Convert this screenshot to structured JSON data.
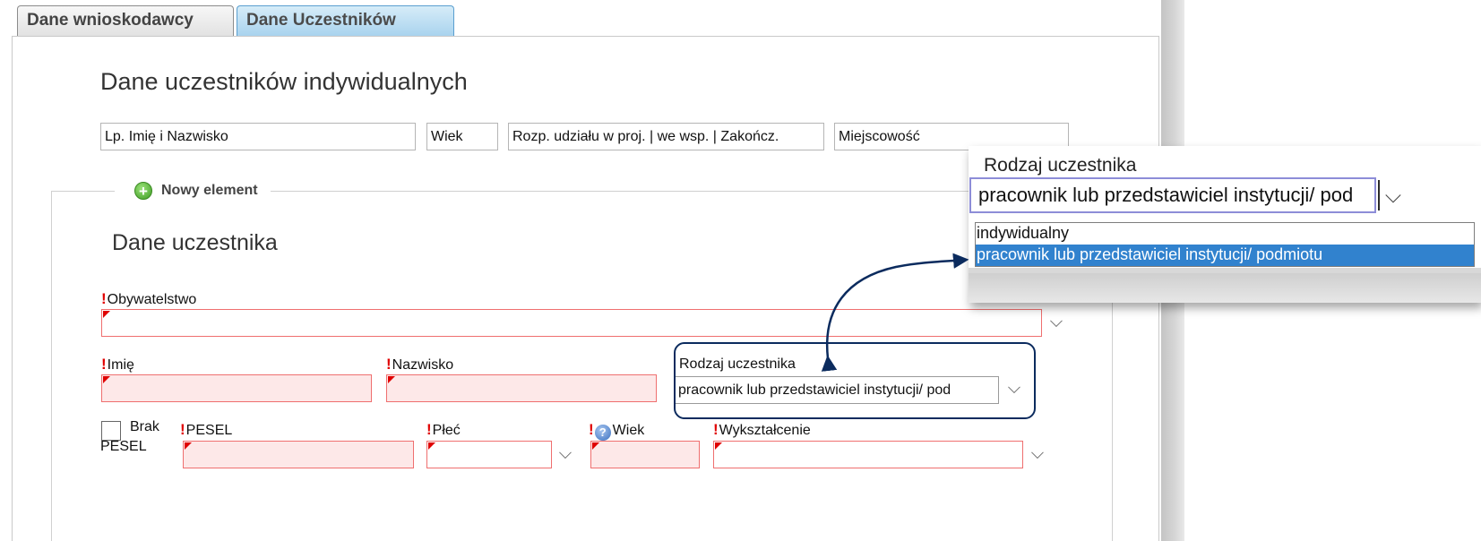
{
  "tabs": [
    {
      "label": "Dane wnioskodawcy"
    },
    {
      "label": "Dane Uczestników"
    }
  ],
  "section_title": "Dane uczestników indywidualnych",
  "columns": [
    "Lp. Imię i Nazwisko",
    "Wiek",
    "Rozp. udziału w proj. | we wsp. | Zakończ.",
    "Miejscowość"
  ],
  "new_element_label": "Nowy element",
  "participant_title": "Dane uczestnika",
  "required_mark": "!",
  "fields": {
    "citizenship": "Obywatelstwo",
    "first_name": "Imię",
    "last_name": "Nazwisko",
    "participant_type": "Rodzaj uczestnika",
    "participant_type_value": "pracownik lub przedstawiciel instytucji/ pod",
    "no_pesel_line1": "Brak",
    "no_pesel_line2": "PESEL",
    "pesel": "PESEL",
    "gender": "Płeć",
    "age": "Wiek",
    "education": "Wykształcenie"
  },
  "zoom": {
    "label": "Rodzaj uczestnika",
    "value": "pracownik lub przedstawiciel instytucji/ pod",
    "options": [
      "indywidualny",
      "pracownik lub przedstawiciel instytucji/ podmiotu"
    ],
    "selected_index": 1
  },
  "colors": {
    "accent": "#3182ce",
    "required": "#e00000",
    "annotation": "#0b2b5e"
  },
  "icons": {
    "add": "plus-circle-icon",
    "help": "question-circle-icon",
    "dropdown": "chevron-down-icon"
  }
}
